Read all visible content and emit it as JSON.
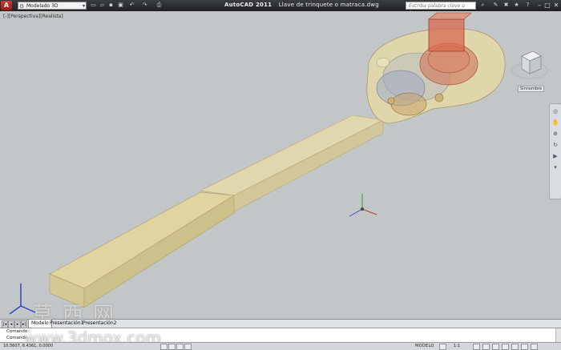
{
  "titlebar": {
    "app_logo": "A",
    "workspace": "Modelado 3D",
    "app_name": "AutoCAD 2011",
    "file_name": "Llave de trinquete o matraca.dwg",
    "search_placeholder": "Escriba palabra clave o frase",
    "quick_access_icons": [
      "new-icon",
      "open-icon",
      "save-icon",
      "save-as-icon",
      "undo-icon",
      "redo-icon",
      "print-icon"
    ],
    "minimize": "–",
    "maximize": "□",
    "close": "✕"
  },
  "viewport": {
    "label": "[-][Perspectiva][Realista]",
    "viewcube_label": "",
    "wcs_label": "Sinnombre"
  },
  "tabs": {
    "items": [
      "Modelo",
      "Presentación1",
      "Presentación2"
    ],
    "active": 0
  },
  "command": {
    "line1": "Comando :",
    "line2": "Comando :"
  },
  "status": {
    "coords": "10.5607, 6.4361, 0.0000",
    "space": "MODELO",
    "annotation_scale": "1:1"
  },
  "watermark": {
    "chinese": "草西网",
    "url": "www.3dmox.com"
  },
  "colors": {
    "handle": "#e2d59a",
    "gear": "#d06b52",
    "background": "#c3c6c8"
  }
}
